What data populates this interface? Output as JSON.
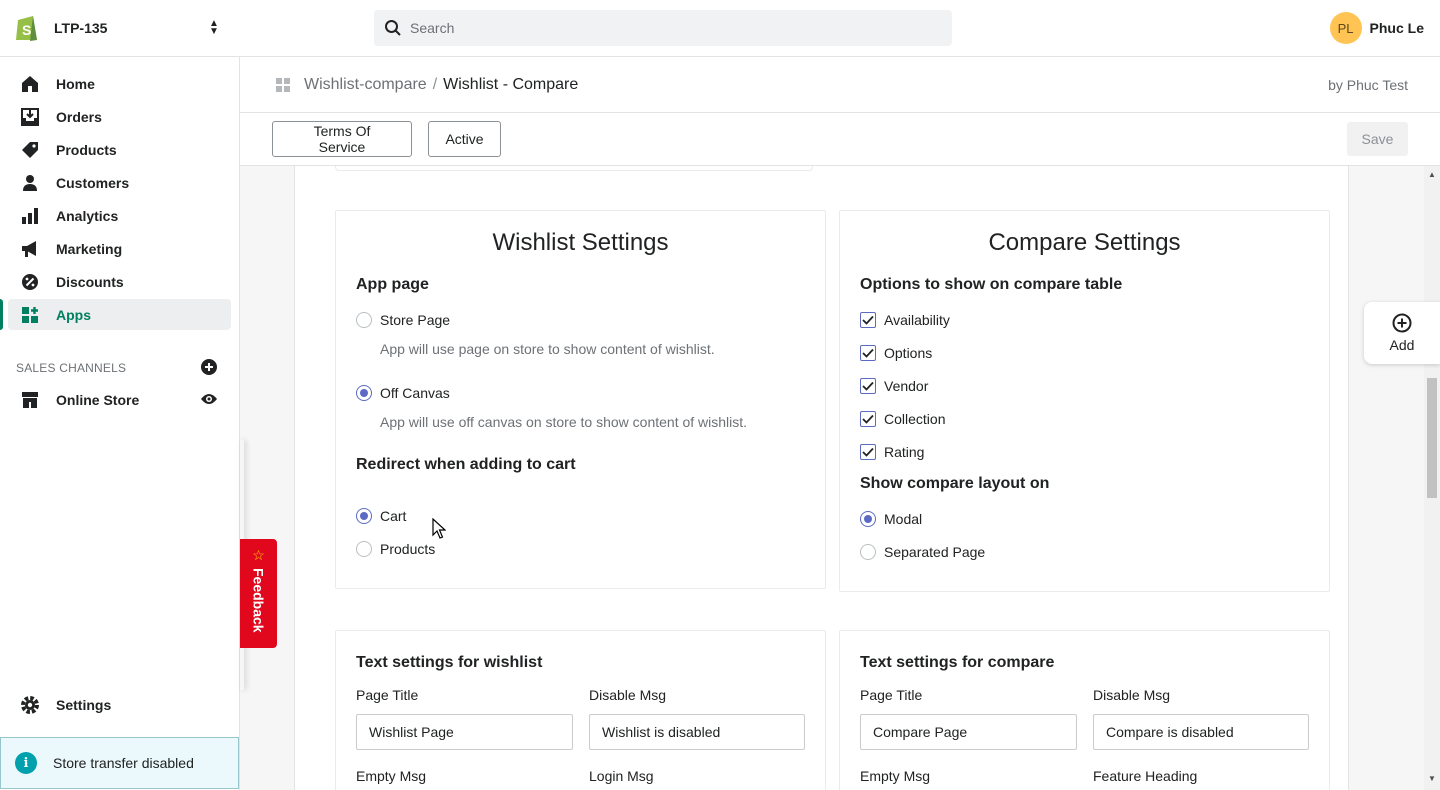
{
  "topbar": {
    "store_name": "LTP-135",
    "search_placeholder": "Search",
    "user_initials": "PL",
    "user_name": "Phuc Le"
  },
  "sidebar": {
    "items": [
      {
        "label": "Home",
        "icon": "home-icon"
      },
      {
        "label": "Orders",
        "icon": "orders-icon"
      },
      {
        "label": "Products",
        "icon": "tag-icon"
      },
      {
        "label": "Customers",
        "icon": "person-icon"
      },
      {
        "label": "Analytics",
        "icon": "bar-chart-icon"
      },
      {
        "label": "Marketing",
        "icon": "megaphone-icon"
      },
      {
        "label": "Discounts",
        "icon": "discount-icon"
      },
      {
        "label": "Apps",
        "icon": "apps-icon"
      }
    ],
    "sales_channels_label": "SALES CHANNELS",
    "online_store_label": "Online Store",
    "settings_label": "Settings",
    "transfer_text": "Store transfer disabled"
  },
  "header": {
    "breadcrumb_link": "Wishlist-compare",
    "breadcrumb_sep": "/",
    "breadcrumb_current": "Wishlist - Compare",
    "byline": "by Phuc Test",
    "terms_label": "Terms Of Service",
    "active_label": "Active",
    "save_label": "Save"
  },
  "wishlist": {
    "title": "Wishlist Settings",
    "app_page_heading": "App page",
    "store_page_label": "Store Page",
    "store_page_help": "App will use page on store to show content of wishlist.",
    "off_canvas_label": "Off Canvas",
    "off_canvas_help": "App will use off canvas on store to show content of wishlist.",
    "redirect_heading": "Redirect when adding to cart",
    "cart_label": "Cart",
    "products_label": "Products"
  },
  "compare": {
    "title": "Compare Settings",
    "options_heading": "Options to show on compare table",
    "options": [
      "Availability",
      "Options",
      "Vendor",
      "Collection",
      "Rating"
    ],
    "layout_heading": "Show compare layout on",
    "modal_label": "Modal",
    "separated_label": "Separated Page"
  },
  "text_wishlist": {
    "heading": "Text settings for wishlist",
    "page_title_label": "Page Title",
    "page_title_value": "Wishlist Page",
    "disable_msg_label": "Disable Msg",
    "disable_msg_value": "Wishlist is disabled",
    "empty_msg_label": "Empty Msg",
    "login_msg_label": "Login Msg"
  },
  "text_compare": {
    "heading": "Text settings for compare",
    "page_title_label": "Page Title",
    "page_title_value": "Compare Page",
    "disable_msg_label": "Disable Msg",
    "disable_msg_value": "Compare is disabled",
    "empty_msg_label": "Empty Msg",
    "feature_heading_label": "Feature Heading"
  },
  "widgets": {
    "add_label": "Add",
    "feedback_label": "Feedback"
  },
  "colors": {
    "accent_green": "#008060",
    "radio_blue": "#5c6ac4",
    "feedback_red": "#e1081e",
    "avatar_yellow": "#ffc453"
  }
}
